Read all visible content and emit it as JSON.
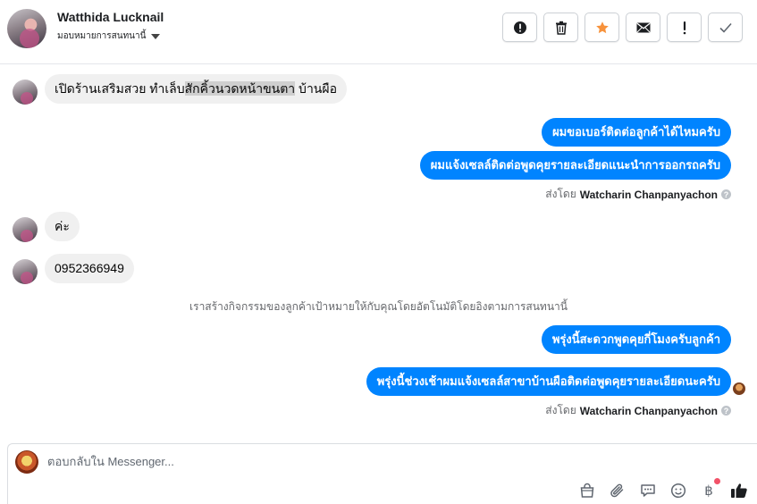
{
  "header": {
    "contact_name": "Watthida Lucknail",
    "assign_label": "มอบหมายการสนทนานี้",
    "actions": [
      {
        "name": "mark-spam",
        "icon": "exclamation-circle-icon"
      },
      {
        "name": "delete",
        "icon": "trash-icon"
      },
      {
        "name": "star",
        "icon": "star-icon",
        "color": "#f7923b"
      },
      {
        "name": "mark-unread",
        "icon": "envelope-icon"
      },
      {
        "name": "follow-up",
        "icon": "exclamation-icon"
      },
      {
        "name": "mark-done",
        "icon": "check-icon"
      }
    ]
  },
  "messages": [
    {
      "direction": "in",
      "text_before": "เปิดร้านเสริมสวย ทำเล็บ",
      "text_highlight": "สักคิ้วนวดหน้าขนตา",
      "text_after": " บ้านผือ"
    },
    {
      "direction": "out",
      "text": "ผมขอเบอร์ติดต่อลูกค้าได้ไหมครับ"
    },
    {
      "direction": "out",
      "text": "ผมแจ้งเซลล์ติดต่อพูดคุยรายละเอียดแนะนำการออกรถครับ"
    },
    {
      "direction": "in",
      "text": "ค่ะ"
    },
    {
      "direction": "in",
      "text": "0952366949"
    },
    {
      "direction": "out",
      "text": "พรุ่งนี้สะดวกพูดคุยกี่โมงครับลูกค้า"
    },
    {
      "direction": "out",
      "text": "พรุ่งนี้ช่วงเช้าผมแจ้งเซลล์สาขาบ้านผือติดต่อพูดคุยรายละเอียดนะครับ"
    }
  ],
  "sent_by": {
    "prefix": "ส่งโดย",
    "name": "Watcharin Chanpanyachon"
  },
  "system_message": "เราสร้างกิจกรรมของลูกค้าเป้าหมายให้กับคุณโดยอัตโนมัติโดยอิงตามการสนทนานี้",
  "composer": {
    "placeholder": "ตอบกลับใน Messenger..."
  },
  "colors": {
    "outgoing_bubble": "#0084ff",
    "incoming_bubble": "#f0f0f0",
    "star": "#f7923b",
    "notification_dot": "#f25268"
  }
}
